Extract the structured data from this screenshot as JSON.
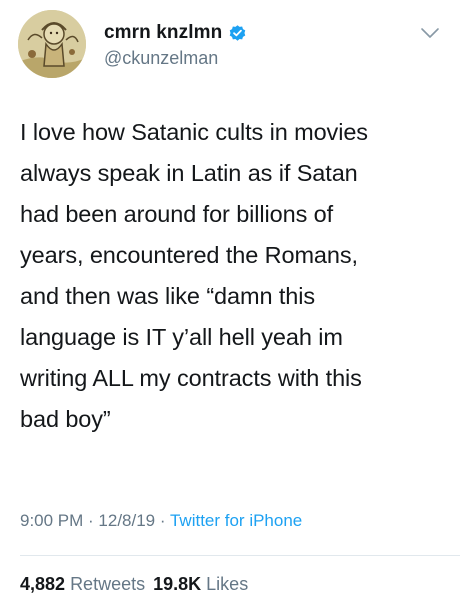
{
  "author": {
    "display_name": "cmrn knzlmn",
    "handle": "@ckunzelman",
    "verified": true,
    "avatar_icon": "avatar-illustration-icon",
    "verified_icon": "verified-badge-icon"
  },
  "menu": {
    "icon": "chevron-down-icon"
  },
  "tweet": {
    "text": "I love how Satanic cults in movies\nalways speak in Latin as if Satan\nhad been around for billions of\nyears, encountered the Romans,\nand then was like “damn this\nlanguage is IT y’all hell yeah im\nwriting ALL my contracts with this\nbad boy”"
  },
  "meta": {
    "time": "9:00 PM",
    "sep1": " · ",
    "date": "12/8/19",
    "sep2": " · ",
    "source": "Twitter for iPhone"
  },
  "stats": {
    "retweets_count": "4,882",
    "retweets_label": "Retweets",
    "likes_count": "19.8K",
    "likes_label": "Likes"
  },
  "colors": {
    "text": "#14171a",
    "secondary": "#657786",
    "link": "#1da1f2",
    "divider": "#e1e8ed"
  }
}
